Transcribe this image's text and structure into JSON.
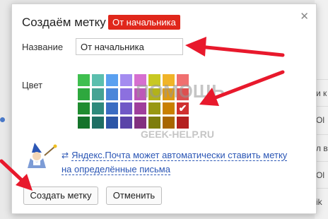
{
  "dialog": {
    "title": "Создаём метку",
    "title_badge": "От начальника",
    "close_icon": "close-icon"
  },
  "form": {
    "name_label": "Название",
    "name_value": "От начальника",
    "color_label": "Цвет"
  },
  "palette": {
    "columns": 8,
    "rows": 4,
    "selected": {
      "row": 2,
      "col": 7
    },
    "colors": [
      [
        "#3fbf4f",
        "#5bbfae",
        "#5aa0f0",
        "#a48cf0",
        "#d66fd0",
        "#c8c823",
        "#f0b428",
        "#f07070"
      ],
      [
        "#2ea83e",
        "#45a394",
        "#4a86d9",
        "#8c70df",
        "#bd56b8",
        "#b2b21a",
        "#dd9a12",
        "#dd5050"
      ],
      [
        "#1f8c2f",
        "#2f8a7c",
        "#3a6cc2",
        "#7058c6",
        "#9f3e9c",
        "#989812",
        "#c98000",
        "#d03030"
      ],
      [
        "#14732a",
        "#1f6f64",
        "#2c55a6",
        "#5a44a8",
        "#82307f",
        "#7d7d0c",
        "#a86600",
        "#b42020"
      ]
    ]
  },
  "watermark": {
    "line1": "ПОМОЩЬ",
    "line2": "GEEK-HELP.RU"
  },
  "promo": {
    "icon": "exchange-icon",
    "text_line1": "Яндекс.Почта может автоматически ставить метку",
    "text_line2": "на определённые письма"
  },
  "buttons": {
    "create_label": "Создать метку",
    "cancel_label": "Отменить"
  },
  "background": {
    "rows": [
      "и к",
      "Ol",
      "л в",
      "Ol",
      "ik"
    ]
  },
  "colors": {
    "badge": "#e0271b",
    "link": "#2b56b5",
    "arrow": "#e8192c"
  }
}
